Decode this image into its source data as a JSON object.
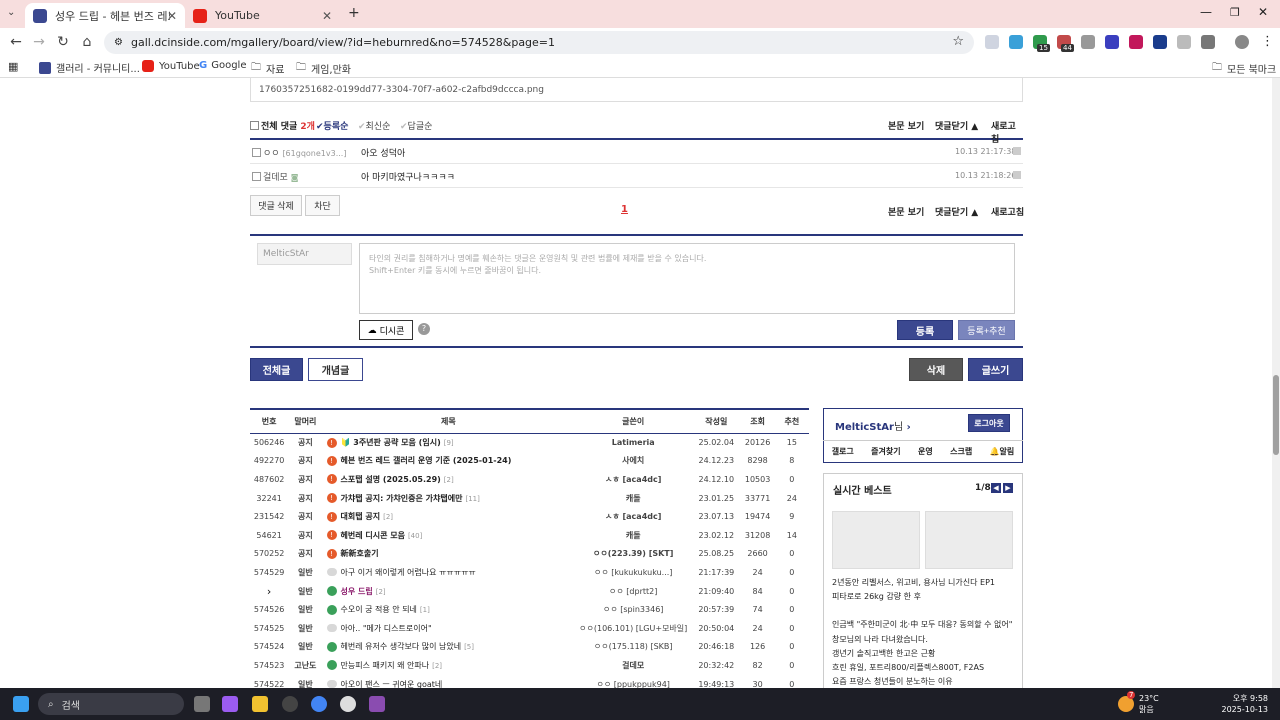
{
  "browser": {
    "tabs": [
      {
        "title": "성우 드립 - 헤븐 번즈 레드 마",
        "active": true
      },
      {
        "title": "YouTube",
        "active": false
      }
    ],
    "url": "gall.dcinside.com/mgallery/board/view/?id=heburnred&no=574528&page=1",
    "bookmarks": [
      "갤러리 - 커뮤니티...",
      "YouTube",
      "Google",
      "자료",
      "게임,만화"
    ],
    "all_bookmarks": "모든 북마크",
    "ext_badges": [
      "15",
      "44"
    ]
  },
  "attachment": {
    "filename": "1760357251682-0199dd77-3304-70f7-a602-c2afbd9dccca.png"
  },
  "comments": {
    "header": {
      "total_label": "전체 댓글",
      "count": "2개",
      "sort_register": "등록순",
      "sort_recent": "최신순",
      "sort_reply": "답글순",
      "view_body": "본문 보기",
      "close_comments": "댓글닫기",
      "refresh": "새로고침"
    },
    "items": [
      {
        "author": "ㅇㅇ",
        "ip": "[61gqone1v3...]",
        "text": "아오 성덕아",
        "time": "10.13 21:17:38"
      },
      {
        "author": "걸데모",
        "ip": "",
        "text": "아 마키마였구나ㅋㅋㅋㅋ",
        "time": "10.13 21:18:26"
      }
    ],
    "delete_btn": "댓글 삭제",
    "block_btn": "차단",
    "page": "1"
  },
  "comment_form": {
    "nickname": "MelticStAr",
    "placeholder_line1": "타인의 권리를 침해하거나 명예를 훼손하는 댓글은 운영원칙 및 관련 법률에 제재를 받을 수 있습니다.",
    "placeholder_line2": "Shift+Enter 키를 동시에 누르면 줄바꿈이 됩니다.",
    "dccon": "디시콘",
    "help": "?",
    "submit": "등록",
    "submit_recommend": "등록+추천"
  },
  "board_buttons": {
    "all": "전체글",
    "concept": "개념글",
    "delete": "삭제",
    "write": "글쓰기"
  },
  "list": {
    "headers": [
      "번호",
      "말머리",
      "제목",
      "글쓴이",
      "작성일",
      "조회",
      "추천"
    ],
    "rows": [
      {
        "no": "506246",
        "head": "공지",
        "icon": "notice",
        "title": "🔰 3주년판 공략 모음 (임시)",
        "count": "[9]",
        "writer": "Latimeria",
        "date": "25.02.04",
        "views": "20126",
        "rec": "15",
        "bold": true
      },
      {
        "no": "492270",
        "head": "공지",
        "icon": "notice",
        "title": "헤븐 번즈 레드 갤러리 운영 기준 (2025-01-24)",
        "count": "",
        "writer": "사에치",
        "date": "24.12.23",
        "views": "8298",
        "rec": "8",
        "bold": true
      },
      {
        "no": "487602",
        "head": "공지",
        "icon": "notice",
        "title": "스포탭 설명 (2025.05.29)",
        "count": "[2]",
        "writer": "ㅅㅎ [aca4dc]",
        "date": "24.12.10",
        "views": "10503",
        "rec": "0",
        "bold": true
      },
      {
        "no": "32241",
        "head": "공지",
        "icon": "notice",
        "title": "가챠탭 공지: 가챠인증은 가챠탭에만",
        "count": "[11]",
        "writer": "캐돌",
        "date": "23.01.25",
        "views": "33771",
        "rec": "24",
        "bold": true
      },
      {
        "no": "231542",
        "head": "공지",
        "icon": "notice",
        "title": "대회탭 공지",
        "count": "[2]",
        "writer": "ㅅㅎ [aca4dc]",
        "date": "23.07.13",
        "views": "19474",
        "rec": "9",
        "bold": true
      },
      {
        "no": "54621",
        "head": "공지",
        "icon": "notice",
        "title": "헤번레 디시콘 모음",
        "count": "[40]",
        "writer": "캐돌",
        "date": "23.02.12",
        "views": "31208",
        "rec": "14",
        "bold": true
      },
      {
        "no": "570252",
        "head": "공지",
        "icon": "notice",
        "title": "新新호출기",
        "count": "",
        "writer": "ㅇㅇ(223.39) [SKT]",
        "date": "25.08.25",
        "views": "2660",
        "rec": "0",
        "bold": true
      },
      {
        "no": "574529",
        "head": "일반",
        "icon": "general",
        "title": "아구 이거 왜이렇게 어렵나요 ㅠㅠㅠㅠㅠ",
        "count": "",
        "writer": "ㅇㅇ [kukukukuku...]",
        "date": "21:17:39",
        "views": "24",
        "rec": "0",
        "bold": false
      },
      {
        "no": "›",
        "head": "일반",
        "icon": "green",
        "title": "성우 드립",
        "count": "[2]",
        "writer": "ㅇㅇ [dprtt2]",
        "date": "21:09:40",
        "views": "84",
        "rec": "0",
        "bold": true,
        "current": true
      },
      {
        "no": "574526",
        "head": "일반",
        "icon": "green",
        "title": "수오이 궁 적용 안 되네",
        "count": "[1]",
        "writer": "ㅇㅇ [spin3346]",
        "date": "20:57:39",
        "views": "74",
        "rec": "0",
        "bold": false
      },
      {
        "no": "574525",
        "head": "일반",
        "icon": "general",
        "title": "아아.. \"메가 디스트로이어\"",
        "count": "",
        "writer": "ㅇㅇ(106.101) [LGU+모바일]",
        "date": "20:50:04",
        "views": "24",
        "rec": "0",
        "bold": false
      },
      {
        "no": "574524",
        "head": "일반",
        "icon": "green",
        "title": "헤번레 유저수 생각보다 많이 남았네",
        "count": "[5]",
        "writer": "ㅇㅇ(175.118) [SKB]",
        "date": "20:46:18",
        "views": "126",
        "rec": "0",
        "bold": false
      },
      {
        "no": "574523",
        "head": "고난도",
        "icon": "green",
        "title": "만능피스 패키지 왜 안파나",
        "count": "[2]",
        "writer": "걸데모",
        "date": "20:32:42",
        "views": "82",
        "rec": "0",
        "bold": false
      },
      {
        "no": "574522",
        "head": "일반",
        "icon": "general",
        "title": "아오이 팬스 ㅡ 귀여운 goat네",
        "count": "",
        "writer": "ㅇㅇ [ppukppuk94]",
        "date": "19:49:13",
        "views": "30",
        "rec": "0",
        "bold": false
      }
    ]
  },
  "sidebar": {
    "user": "MelticStAr",
    "user_suffix": "님",
    "logout": "로그아웃",
    "menu": [
      "갤로그",
      "즐겨찾기",
      "운영",
      "스크랩",
      "알림"
    ],
    "best_title": "실시간 베스트",
    "best_page": "1/8",
    "best_items": [
      "2년동안 리벨서스, 위고비,  용사님 니가신다 EP1",
      "피타로로 26kg 감량 한 후",
      "인금백 \"주한미군이 北·中 모두 대응? 동의할 수 없어\"",
      "창모님의 나라 다녀왔습니다.",
      "갱년기 솔직고백한 한고은 근황",
      "흐린 휴일, 포트리800/리플렉스800T, F2AS",
      "요즘 프랑스 청년들이 분노하는 이유"
    ]
  },
  "taskbar": {
    "search": "검색",
    "weather_temp": "23°C",
    "weather_desc": "맑음",
    "weather_badge": "7",
    "time": "오후 9:58",
    "date": "2025-10-13"
  },
  "colors": {
    "accent": "#3b4890",
    "tab_bg": "#f7dede",
    "notice": "#e55a2a"
  }
}
